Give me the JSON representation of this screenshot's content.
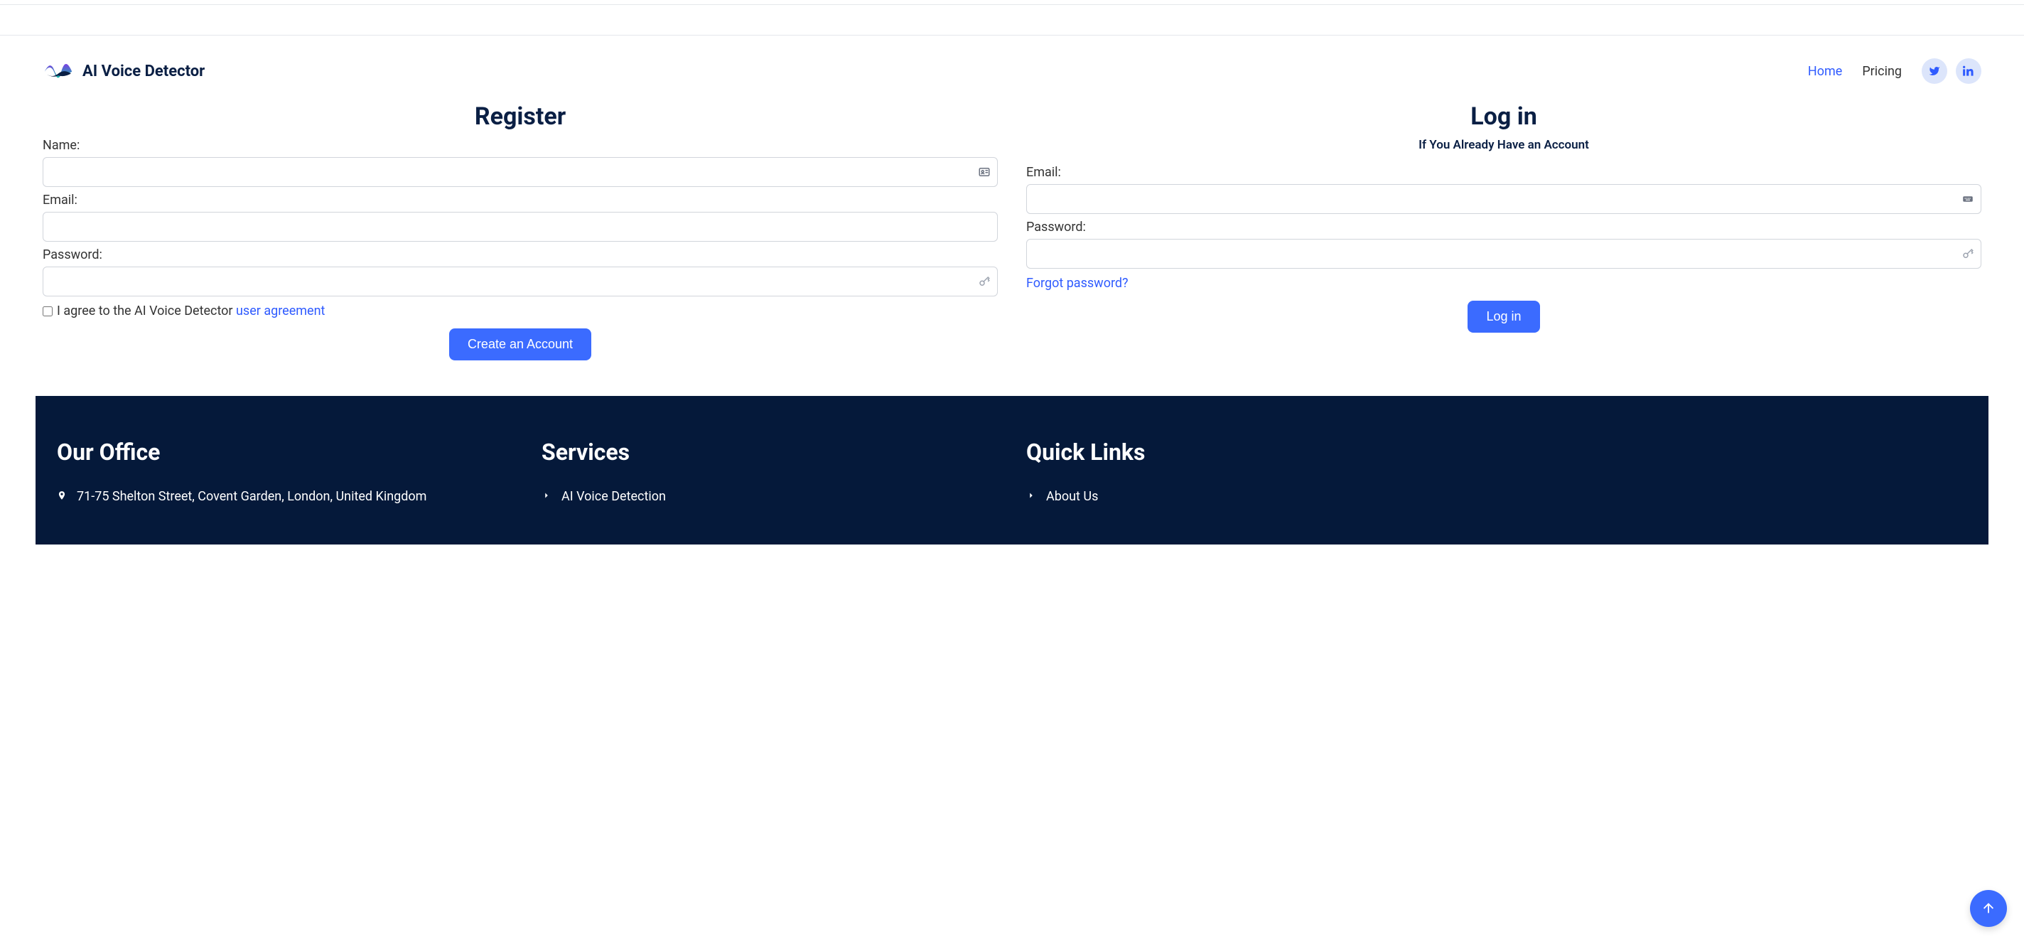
{
  "brand": {
    "name": "AI Voice Detector"
  },
  "nav": {
    "home": "Home",
    "pricing": "Pricing"
  },
  "register": {
    "title": "Register",
    "name_label": "Name:",
    "email_label": "Email:",
    "password_label": "Password:",
    "agree_prefix": "I agree to the AI Voice Detector ",
    "agree_link": "user agreement",
    "submit": "Create an Account"
  },
  "login": {
    "title": "Log in",
    "subtitle": "If You Already Have an Account",
    "email_label": "Email:",
    "password_label": "Password:",
    "forgot": "Forgot password?",
    "submit": "Log in"
  },
  "footer": {
    "office_title": "Our Office",
    "address": "71-75 Shelton Street, Covent Garden, London, United Kingdom",
    "services_title": "Services",
    "service_1": "AI Voice Detection",
    "links_title": "Quick Links",
    "link_1": "About Us"
  }
}
